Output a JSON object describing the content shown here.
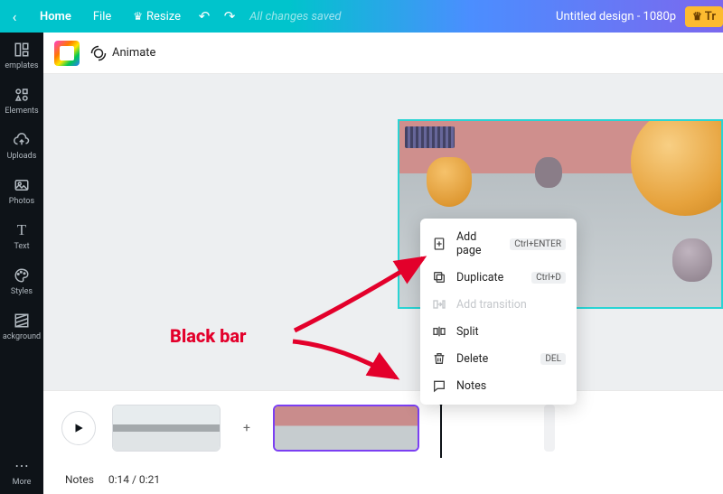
{
  "topbar": {
    "home": "Home",
    "file": "File",
    "resize": "Resize",
    "saved": "All changes saved",
    "title": "Untitled design - 1080p",
    "try": "Tr"
  },
  "sidebar": {
    "templates": "emplates",
    "elements": "Elements",
    "uploads": "Uploads",
    "photos": "Photos",
    "text": "Text",
    "styles": "Styles",
    "background": "ackground",
    "more": "More"
  },
  "toolbar2": {
    "animate": "Animate"
  },
  "ctx": {
    "addpage": "Add page",
    "addpage_kbd": "Ctrl+ENTER",
    "duplicate": "Duplicate",
    "duplicate_kbd": "Ctrl+D",
    "addtransition": "Add transition",
    "split": "Split",
    "delete": "Delete",
    "delete_kbd": "DEL",
    "notes": "Notes"
  },
  "status": {
    "notes": "Notes",
    "time": "0:14 / 0:21"
  },
  "annotation": {
    "label": "Black bar"
  }
}
